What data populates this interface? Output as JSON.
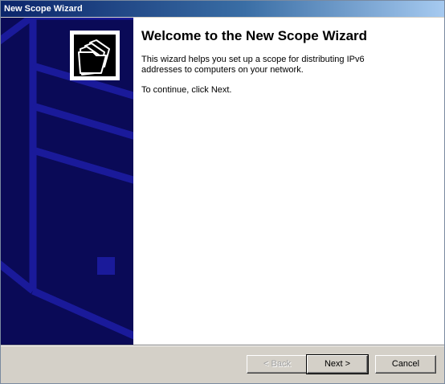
{
  "window": {
    "title": "New Scope Wizard"
  },
  "welcome": {
    "heading": "Welcome to the New Scope Wizard",
    "description": "This wizard helps you set up a scope for distributing IPv6 addresses to computers on your network.",
    "instruction": "To continue, click Next."
  },
  "buttons": {
    "back_label": "< Back",
    "next_label": "Next >",
    "cancel_label": "Cancel"
  },
  "icons": {
    "wizard": "folders-icon"
  },
  "colors": {
    "banner": "#0a0a57",
    "banner_art": "#1a1a9a",
    "titlebar": "#0a246a",
    "dialog_face": "#d4d0c8"
  }
}
